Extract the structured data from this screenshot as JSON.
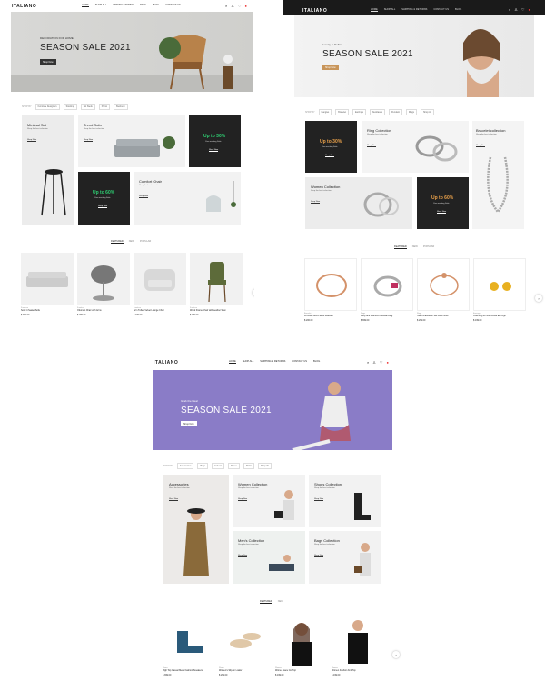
{
  "shot1": {
    "logo": "ITALIANO",
    "menu": [
      "HOME",
      "SHOP ALL",
      "TRENDY STORIES",
      "PAGE",
      "BLOG",
      "CONTACT US"
    ],
    "hero": {
      "subtitle": "DECORATION FOR HOME",
      "title": "SEASON SALE 2021",
      "button": "Shop Now"
    },
    "shop_by": {
      "label": "SHOP BY",
      "items": [
        "Furniture Designers",
        "Stocking",
        "Ski Sleds",
        "Picnic",
        "Bedroom"
      ]
    },
    "tiles": [
      {
        "title": "Minimal Set",
        "sub": "Shop the best selection",
        "btn": "Shop Now"
      },
      {
        "title": "Trend Sofa",
        "sub": "Shop the best selection",
        "btn": "Shop Now"
      },
      {
        "title": "Up to 30%",
        "sub": "Your exciting Sale",
        "btn": "Shop Now"
      },
      {
        "title": "Up to 60%",
        "sub": "Your exciting Sale",
        "btn": "Shop Now"
      },
      {
        "title": "Comfort Chair",
        "sub": "Shop the best selection",
        "btn": "Shop Now"
      }
    ],
    "product_tabs": [
      "FEATURED",
      "NEW",
      "POPULAR"
    ],
    "products": [
      {
        "cat": "Furniture",
        "name": "Sony 4 Seater Sofa",
        "price": "$ 399.00"
      },
      {
        "cat": "Furniture",
        "name": "Ottoman Chair with Arms",
        "price": "$ 299.00"
      },
      {
        "cat": "Furniture",
        "name": "Arm Tufted Velvet Lounge Chair",
        "price": "$ 199.00"
      },
      {
        "cat": "Furniture",
        "name": "Wood Frame Chair with Leather Seat",
        "price": "$ 199.00"
      }
    ]
  },
  "shot2": {
    "logo": "ITALIANO",
    "menu": [
      "HOME",
      "SHOP ALL",
      "SHIPPING & RETURNS",
      "CONTACT US",
      "BLOG"
    ],
    "hero": {
      "subtitle": "Luxury in Define",
      "title": "SEASON SALE 2021",
      "button": "Shop Now"
    },
    "shop_by": {
      "label": "SHOP BY",
      "items": [
        "Bangles",
        "Bracelet",
        "Earrings",
        "Necklaces",
        "Pendant",
        "Rings",
        "Shop All"
      ]
    },
    "tiles": [
      {
        "title": "Up to 30%",
        "sub": "Your exciting Sale",
        "btn": "Shop Now"
      },
      {
        "title": "Ring Collection",
        "sub": "Shop the best selection",
        "btn": "Shop Now"
      },
      {
        "title": "Bracelet collection",
        "sub": "Shop the best selection",
        "btn": "Shop Now"
      },
      {
        "title": "Women Collection",
        "sub": "Shop the best selection",
        "btn": "Shop Now"
      },
      {
        "title": "Up to 60%",
        "sub": "Your exciting Sale",
        "btn": "Shop Now"
      }
    ],
    "product_tabs": [
      "FEATURED",
      "NEW",
      "POPULAR"
    ],
    "products": [
      {
        "cat": "Bracelet",
        "name": "18 Rose Gold Plated Bracelet",
        "price": "$ 200.00"
      },
      {
        "cat": "Rings",
        "name": "Ruby and Diamond Cocktail Ring",
        "price": "$ 399.00"
      },
      {
        "cat": "Rings",
        "name": "Heart Bracelet in 18k Rose Gold",
        "price": "$ 299.00"
      },
      {
        "cat": "Earrings",
        "name": "Charming 22 Gold Floral Earrings",
        "price": "$ 199.00"
      }
    ]
  },
  "shot3": {
    "logo": "ITALIANO",
    "menu": [
      "HOME",
      "SHOP ALL",
      "SHIPPING & RETURNS",
      "CONTACT US",
      "BLOG"
    ],
    "hero": {
      "subtitle": "Grab the Deal",
      "title": "SEASON SALE 2021",
      "button": "Shop Now"
    },
    "shop_by": {
      "label": "SHOP BY",
      "items": [
        "Accessories",
        "Bags",
        "Jackets",
        "Shoes",
        "Shirts",
        "Shop All"
      ]
    },
    "tiles": [
      {
        "title": "Accessories",
        "sub": "Shop the best selection",
        "btn": "Shop Now"
      },
      {
        "title": "Women Collection",
        "sub": "Shop the best selection",
        "btn": "Shop Now"
      },
      {
        "title": "Shoes Collection",
        "sub": "Shop the best selection",
        "btn": "Shop Now"
      },
      {
        "title": "Men's Collection",
        "sub": "Shop the best selection",
        "btn": "Shop Now"
      },
      {
        "title": "Bags Collection",
        "sub": "Shop the best selection",
        "btn": "Shop Now"
      }
    ],
    "product_tabs": [
      "FEATURED",
      "NEW"
    ],
    "products": [
      {
        "cat": "Shoes",
        "name": "High Top Casual Mens Fashion Sneakers",
        "price": "$ 399.00"
      },
      {
        "cat": "Shoes",
        "name": "Women's Slip-on Loafer",
        "price": "$ 299.00"
      },
      {
        "cat": "Women",
        "name": "Women Lace Cut Top",
        "price": "$ 199.00"
      },
      {
        "cat": "Women",
        "name": "Women Fashion Knit Top",
        "price": "$ 199.00"
      }
    ]
  }
}
